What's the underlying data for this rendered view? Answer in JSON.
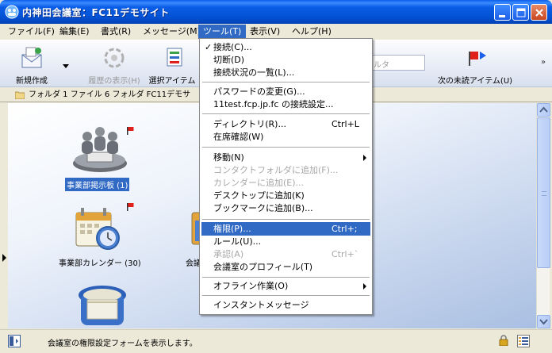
{
  "window": {
    "title": "内神田会議室：FC11デモサイト"
  },
  "menu_bar": [
    {
      "label": "ファイル(F)",
      "active": false
    },
    {
      "label": "編集(E)",
      "active": false
    },
    {
      "label": "書式(R)",
      "active": false
    },
    {
      "label": "メッセージ(M)",
      "active": false
    },
    {
      "label": "ツール(T)",
      "active": true
    },
    {
      "label": "表示(V)",
      "active": false
    },
    {
      "label": "ヘルプ(H)",
      "active": false
    }
  ],
  "toolbar": {
    "new_label": "新規作成",
    "history_label": "履歴の表示(H)",
    "select_label": "選択アイテム",
    "filter_placeholder": "ィルタ",
    "next_unread_label": "次の未読アイテム(U)",
    "more": "»"
  },
  "breadcrumb": {
    "text": "フォルダ  1 ファイル  6 フォルダ  FC11デモサ"
  },
  "folders": [
    {
      "label": "事業部掲示板 (1)",
      "selected": true
    },
    {
      "label": "事業部カレンダー (30)",
      "selected": false
    },
    {
      "label": "会議",
      "selected": false
    }
  ],
  "tools_menu": {
    "items": [
      {
        "label": "接続(C)...",
        "checked": true,
        "disabled": false,
        "shortcut": "",
        "submenu": false
      },
      {
        "label": "切断(D)",
        "checked": false,
        "disabled": false,
        "shortcut": "",
        "submenu": false
      },
      {
        "label": "接続状況の一覧(L)...",
        "checked": false,
        "disabled": false,
        "shortcut": "",
        "submenu": false
      },
      {
        "label": "パスワードの変更(G)...",
        "checked": false,
        "disabled": false,
        "shortcut": "",
        "submenu": false
      },
      {
        "label": "11test.fcp.jp.fc の接続設定...",
        "checked": false,
        "disabled": false,
        "shortcut": "",
        "submenu": false
      },
      {
        "label": "ディレクトリ(R)...",
        "checked": false,
        "disabled": false,
        "shortcut": "Ctrl+L",
        "submenu": false
      },
      {
        "label": "在席確認(W)",
        "checked": false,
        "disabled": false,
        "shortcut": "",
        "submenu": false
      },
      {
        "label": "移動(N)",
        "checked": false,
        "disabled": false,
        "shortcut": "",
        "submenu": true
      },
      {
        "label": "コンタクトフォルダに追加(F)...",
        "checked": false,
        "disabled": true,
        "shortcut": "",
        "submenu": false
      },
      {
        "label": "カレンダーに追加(E)...",
        "checked": false,
        "disabled": true,
        "shortcut": "",
        "submenu": false
      },
      {
        "label": "デスクトップに追加(K)",
        "checked": false,
        "disabled": false,
        "shortcut": "",
        "submenu": false
      },
      {
        "label": "ブックマークに追加(B)...",
        "checked": false,
        "disabled": false,
        "shortcut": "",
        "submenu": false
      },
      {
        "label": "権限(P)...",
        "checked": false,
        "disabled": false,
        "shortcut": "Ctrl+;",
        "submenu": false,
        "highlighted": true
      },
      {
        "label": "ルール(U)...",
        "checked": false,
        "disabled": false,
        "shortcut": "",
        "submenu": false
      },
      {
        "label": "承認(A)",
        "checked": false,
        "disabled": true,
        "shortcut": "Ctrl+`",
        "submenu": false
      },
      {
        "label": "会議室のプロフィール(T)",
        "checked": false,
        "disabled": false,
        "shortcut": "",
        "submenu": false
      },
      {
        "label": "オフライン作業(O)",
        "checked": false,
        "disabled": false,
        "shortcut": "",
        "submenu": true
      },
      {
        "label": "インスタントメッセージ",
        "checked": false,
        "disabled": false,
        "shortcut": "",
        "submenu": false
      }
    ],
    "check_mark": "✓"
  },
  "status_bar": {
    "text": "会議室の権限設定フォームを表示します。"
  },
  "colors": {
    "title_blue": "#0453d6",
    "highlight": "#316ac5",
    "flag_red": "#e0201a"
  }
}
